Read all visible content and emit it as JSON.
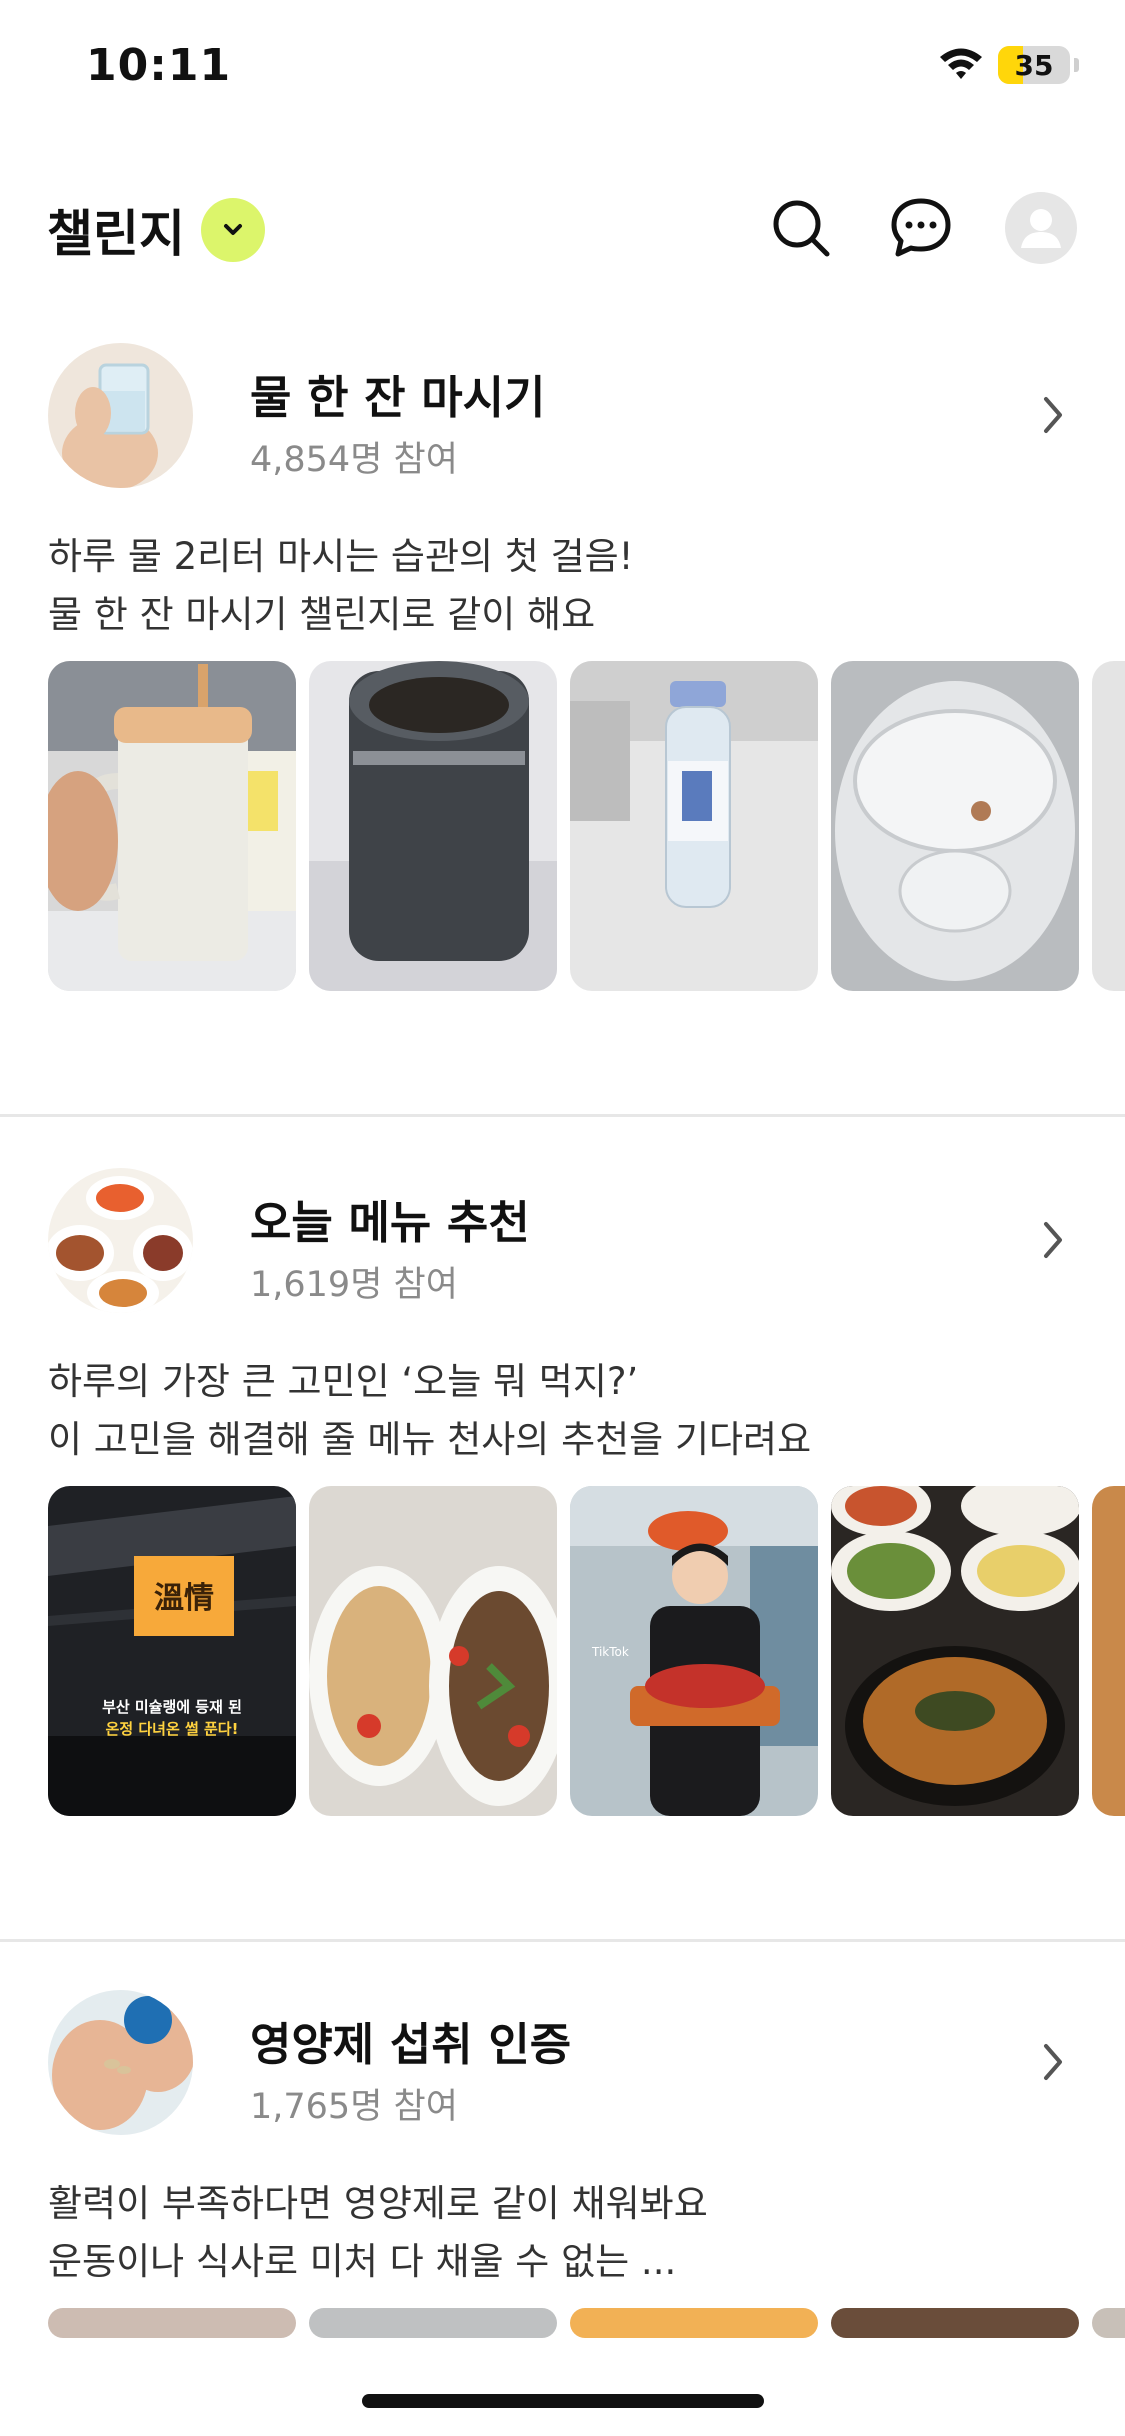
{
  "status_bar": {
    "time": "10:11",
    "battery": "35",
    "battery_level": 0.35
  },
  "header": {
    "title": "챌린지",
    "icons": [
      "chevron-down-icon",
      "search-icon",
      "chat-icon",
      "profile-icon"
    ]
  },
  "challenges": [
    {
      "title": "물 한 잔 마시기",
      "participants": "4,854명 참여",
      "description_line1": "하루 물 2리터 마시는 습관의 첫 걸음!",
      "description_line2": "물 한 잔 마시기 챌린지로 같이 해요"
    },
    {
      "title": "오늘 메뉴 추천",
      "participants": "1,619명 참여",
      "description_line1": "하루의 가장 큰 고민인 ‘오늘 뭐 먹지?’",
      "description_line2": "이 고민을 해결해 줄 메뉴 천사의 추천을 기다려요",
      "photo_caption_sign": "溫情",
      "photo_caption_line1": "부산 미슐랭에 등재 된",
      "photo_caption_line2": "온정 다녀온 썰 푼다!",
      "photo_caption_tiktok": "TikTok"
    },
    {
      "title": "영양제 섭취 인증",
      "participants": "1,765명 참여",
      "description_line1": "활력이 부족하다면 영양제로 같이 채워봐요",
      "description_line2": "운동이나 식사로 미처 다 채울 수 없는 ..."
    }
  ],
  "colors": {
    "accent": "#dcf56b",
    "battery": "#ffd60a",
    "muted_text": "#8a8a8a",
    "divider": "#e7e7e7"
  }
}
